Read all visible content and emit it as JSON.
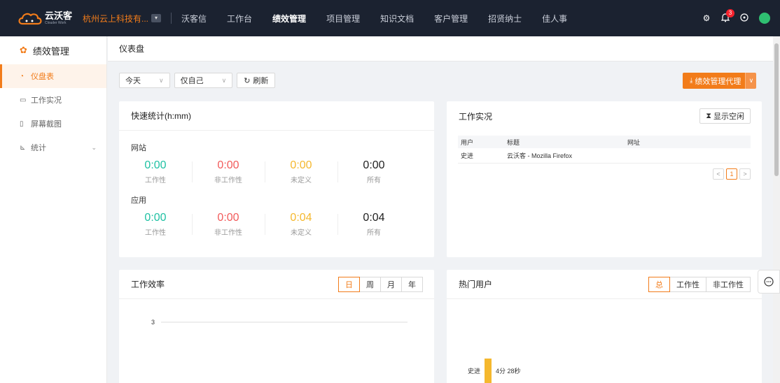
{
  "topbar": {
    "logo_cn": "云沃客",
    "logo_en": "Clouder Work",
    "company": "杭州云上科技有...",
    "nav": [
      "沃客信",
      "工作台",
      "绩效管理",
      "项目管理",
      "知识文档",
      "客户管理",
      "招贤纳士",
      "佳人事"
    ],
    "active_nav": "绩效管理",
    "notification_count": "3",
    "icons": [
      "settings-icon",
      "bell-icon",
      "help-icon",
      "avatar"
    ]
  },
  "sidebar": {
    "title": "绩效管理",
    "items": [
      {
        "label": "仪盘表",
        "icon": "dashboard-icon"
      },
      {
        "label": "工作实况",
        "icon": "monitor-icon"
      },
      {
        "label": "屏幕截图",
        "icon": "screenshot-icon"
      },
      {
        "label": "统计",
        "icon": "chart-icon"
      }
    ]
  },
  "page": {
    "title": "仪表盘"
  },
  "toolbar": {
    "range": "今天",
    "scope": "仅自己",
    "refresh": "刷新",
    "agent": "绩效管理代理"
  },
  "quick_stats": {
    "title": "快速统计(h:mm)",
    "website": {
      "label": "网站",
      "stats": [
        {
          "value": "0:00",
          "label": "工作性"
        },
        {
          "value": "0:00",
          "label": "非工作性"
        },
        {
          "value": "0:00",
          "label": "未定义"
        },
        {
          "value": "0:00",
          "label": "所有"
        }
      ]
    },
    "app": {
      "label": "应用",
      "stats": [
        {
          "value": "0:00",
          "label": "工作性"
        },
        {
          "value": "0:00",
          "label": "非工作性"
        },
        {
          "value": "0:04",
          "label": "未定义"
        },
        {
          "value": "0:04",
          "label": "所有"
        }
      ]
    },
    "colors": {
      "work": "#1fc1a3",
      "nonwork": "#f25a5a",
      "undefined": "#f5b82e",
      "all": "#222222"
    }
  },
  "work_live": {
    "title": "工作实况",
    "show_idle": "显示空闲",
    "columns": [
      "用户",
      "标题",
      "网址"
    ],
    "rows": [
      {
        "user": "史进",
        "title": "云沃客 - Mozilla Firefox",
        "url": ""
      }
    ],
    "page": "1"
  },
  "efficiency": {
    "title": "工作效率",
    "periods": [
      "日",
      "周",
      "月",
      "年"
    ],
    "active": "日",
    "y_tick": "3"
  },
  "hot_users": {
    "title": "热门用户",
    "filters": [
      "总",
      "工作性",
      "非工作性"
    ],
    "active": "总",
    "user": "史进",
    "duration": "4分 28秒"
  },
  "chart_data": [
    {
      "type": "line",
      "title": "工作效率",
      "yticks": [
        "3"
      ],
      "series": []
    },
    {
      "type": "bar",
      "title": "热门用户",
      "categories": [
        "史进"
      ],
      "values": [
        268
      ],
      "data_labels": [
        "4分 28秒"
      ],
      "bar_color": "#f5b82e"
    }
  ],
  "accent": "#f27c1a"
}
